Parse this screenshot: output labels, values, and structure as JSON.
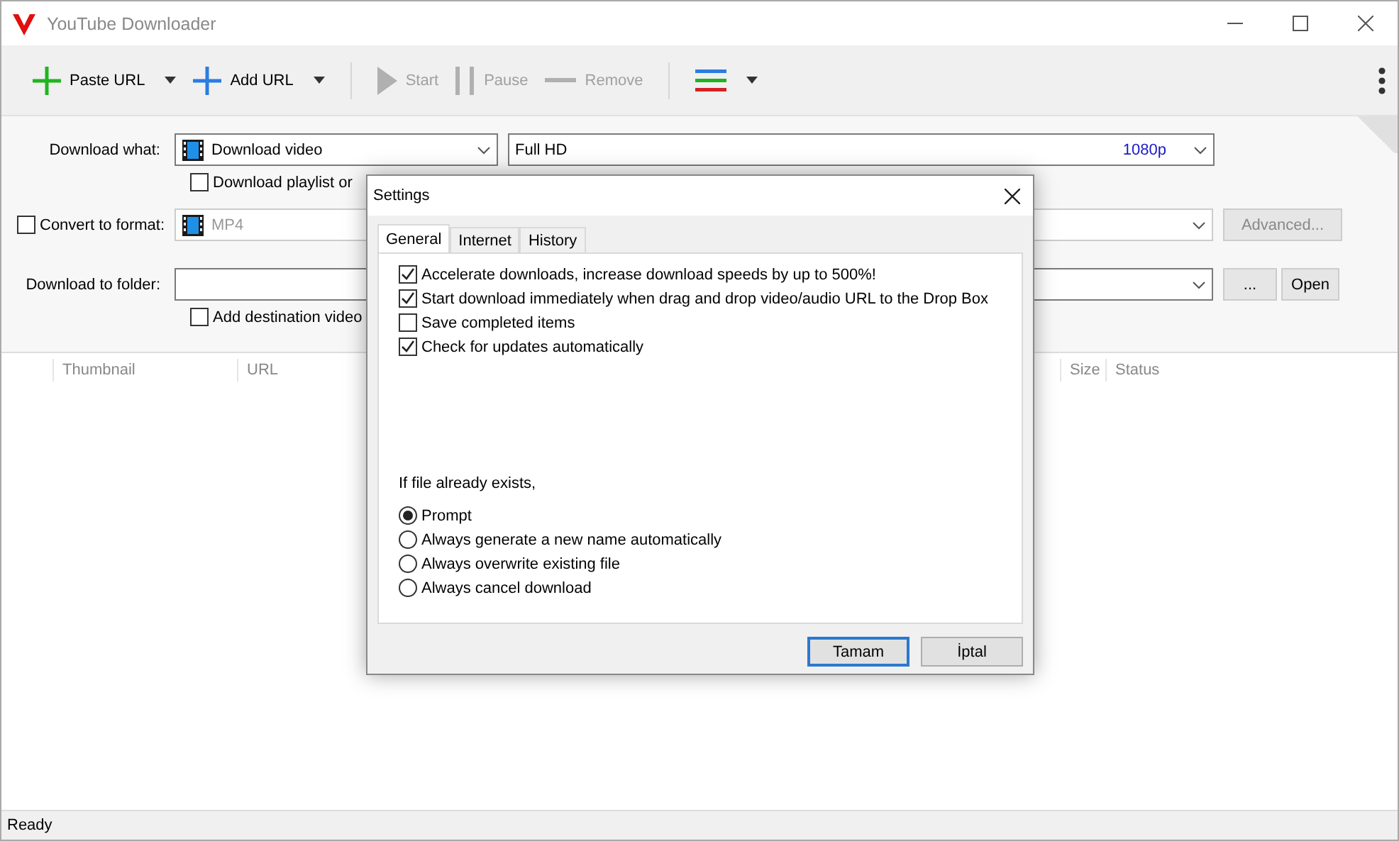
{
  "window": {
    "title": "YouTube Downloader"
  },
  "toolbar": [
    {
      "kind": "plus",
      "label": "Paste URL",
      "color": "#1fb41f",
      "disabled": false,
      "dropdown": true
    },
    {
      "kind": "plus",
      "label": "Add URL",
      "color": "#2a7de1",
      "disabled": false,
      "dropdown": true
    },
    {
      "kind": "separator"
    },
    {
      "kind": "play",
      "label": "Start",
      "disabled": true,
      "dropdown": false
    },
    {
      "kind": "pause",
      "label": "Pause",
      "disabled": true,
      "dropdown": false
    },
    {
      "kind": "minus",
      "label": "Remove",
      "disabled": true,
      "dropdown": false
    },
    {
      "kind": "separator"
    },
    {
      "kind": "lines",
      "disabled": false,
      "dropdown": true
    }
  ],
  "form": {
    "download_what": {
      "label": "Download what:",
      "type": "Download video",
      "quality": "Full HD",
      "resolution": "1080p"
    },
    "playlist": {
      "label": "Download playlist or",
      "checked": false
    },
    "convert": {
      "label": "Convert to format:",
      "checked": false,
      "format": "MP4",
      "advanced": "Advanced..."
    },
    "folder": {
      "label": "Download to folder:",
      "browse": "...",
      "open": "Open"
    },
    "destination": {
      "label": "Add destination video",
      "checked": false
    }
  },
  "table": {
    "columns": [
      "Thumbnail",
      "URL",
      "Size",
      "Status"
    ]
  },
  "status_bar": "Ready",
  "dialog": {
    "title": "Settings",
    "tabs": [
      {
        "label": "General",
        "selected": true
      },
      {
        "label": "Internet",
        "selected": false
      },
      {
        "label": "History",
        "selected": false
      }
    ],
    "options": [
      {
        "label": "Accelerate downloads, increase download speeds by up to 500%!",
        "checked": true
      },
      {
        "label": "Start download immediately when drag and drop video/audio URL to the Drop Box",
        "checked": true
      },
      {
        "label": "Save completed items",
        "checked": false
      },
      {
        "label": "Check for updates automatically",
        "checked": true
      }
    ],
    "exists_label": "If file already exists,",
    "exists_options": [
      {
        "label": "Prompt",
        "selected": true
      },
      {
        "label": "Always generate a new name automatically",
        "selected": false
      },
      {
        "label": "Always overwrite existing file",
        "selected": false
      },
      {
        "label": "Always cancel download",
        "selected": false
      }
    ],
    "buttons": [
      {
        "label": "Tamam",
        "default": true
      },
      {
        "label": "İptal",
        "default": false
      }
    ]
  }
}
